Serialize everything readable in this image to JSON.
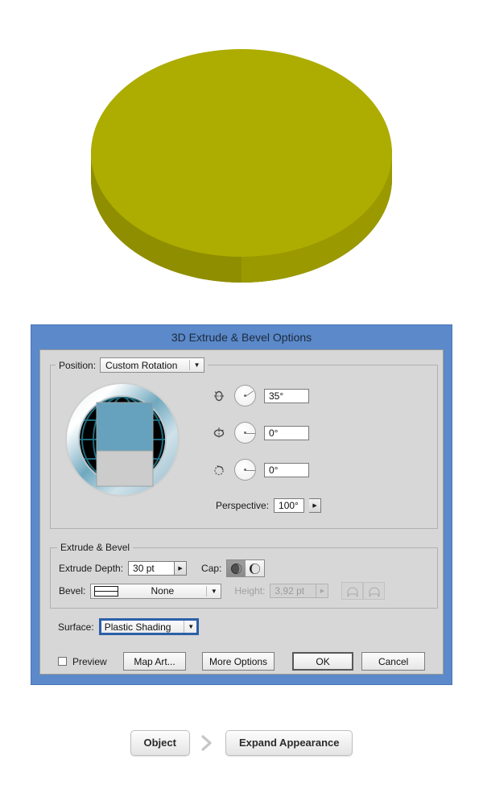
{
  "artwork": {
    "name": "extruded-ellipse-3d-object",
    "top_face_color": "#adac00",
    "side_face_color": "#8f8e00",
    "side_shade_color": "#9a9900"
  },
  "dialog": {
    "title": "3D Extrude & Bevel Options",
    "titlebar_color": "#5b89c9",
    "body_color": "#d7d7d7",
    "position": {
      "label": "Position:",
      "value": "Custom Rotation",
      "arrow_icon": "chevron-down-icon"
    },
    "rotation": {
      "axes": [
        {
          "icon": "rotate-x-axis-icon",
          "value": "35°",
          "angle": -35
        },
        {
          "icon": "rotate-y-axis-icon",
          "value": "0°",
          "angle": 0
        },
        {
          "icon": "rotate-z-axis-icon",
          "value": "0°",
          "angle": 0
        }
      ],
      "perspective": {
        "label": "Perspective:",
        "value": "100°",
        "stepper_icon": "stepper-arrow-icon"
      }
    },
    "extrude_bevel": {
      "legend": "Extrude & Bevel",
      "extrude_depth": {
        "label": "Extrude Depth:",
        "value": "30 pt",
        "stepper_icon": "stepper-arrow-icon"
      },
      "cap": {
        "label": "Cap:",
        "solid_icon": "cap-solid-icon",
        "hollow_icon": "cap-hollow-icon",
        "selected": "solid"
      },
      "bevel": {
        "label": "Bevel:",
        "value": "None",
        "swatch_icon": "bevel-none-icon",
        "arrow_icon": "chevron-down-icon"
      },
      "height": {
        "label": "Height:",
        "value": "3,92 pt",
        "enabled": false,
        "stepper_icon": "stepper-arrow-icon",
        "bevel_out_icon": "bevel-extent-out-icon",
        "bevel_in_icon": "bevel-extent-in-icon"
      }
    },
    "surface": {
      "label": "Surface:",
      "value": "Plastic Shading",
      "arrow_icon": "chevron-down-icon"
    },
    "footer": {
      "preview_label": "Preview",
      "preview_checked": false,
      "map_art_label": "Map Art...",
      "more_options_label": "More Options",
      "ok_label": "OK",
      "cancel_label": "Cancel"
    }
  },
  "breadcrumb": {
    "steps": [
      {
        "label": "Object"
      },
      {
        "label": "Expand Appearance"
      }
    ],
    "separator_icon": "chevron-right-icon"
  }
}
